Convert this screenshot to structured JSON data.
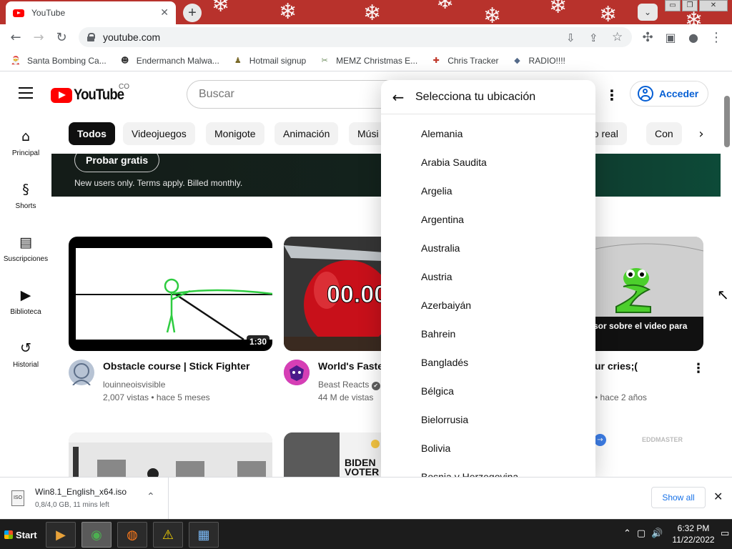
{
  "browser": {
    "tab_title": "YouTube",
    "tab_close": "✕",
    "new_tab": "+",
    "url": "youtube.com",
    "window_buttons": [
      "▭",
      "❐",
      "✕"
    ],
    "tab_search": "⌄",
    "nav_icons": {
      "back": "←",
      "forward": "→",
      "reload": "↻"
    },
    "omnibox_icons": {
      "install": "⇩",
      "share": "⇪",
      "star": "☆"
    },
    "toolbar_icons": {
      "extensions": "✣",
      "sidepanel": "▣",
      "profile": "●",
      "menu": "⋮"
    }
  },
  "bookmarks": [
    {
      "label": "Santa Bombing Ca...",
      "icon": "🎅",
      "color": "#c0392b"
    },
    {
      "label": "Endermanch Malwa...",
      "icon": "☻",
      "color": "#333333"
    },
    {
      "label": "Hotmail signup",
      "icon": "♟",
      "color": "#7a6a2a"
    },
    {
      "label": "MEMZ Christmas E...",
      "icon": "✂",
      "color": "#6a8a5a"
    },
    {
      "label": "Chris Tracker",
      "icon": "✚",
      "color": "#c0392b"
    },
    {
      "label": "RADIO!!!!",
      "icon": "◆",
      "color": "#556b8a"
    }
  ],
  "youtube": {
    "logo_text": "YouTube",
    "country_code": "CO",
    "search_placeholder": "Buscar",
    "more_icon": "⋮",
    "signin_label": "Acceder"
  },
  "chips": [
    "Todos",
    "Videojuegos",
    "Monigote",
    "Animación",
    "Músi",
    "po real",
    "Con"
  ],
  "chip_next": "›",
  "nav": [
    {
      "label": "Principal",
      "icon": "⌂"
    },
    {
      "label": "Shorts",
      "icon": "§"
    },
    {
      "label": "Suscripciones",
      "icon": "▤"
    },
    {
      "label": "Biblioteca",
      "icon": "▶"
    },
    {
      "label": "Historial",
      "icon": "↺"
    }
  ],
  "banner": {
    "button": "Probar gratis",
    "note": "New users only. Terms apply. Billed monthly."
  },
  "videos": [
    {
      "title": "Obstacle course | Stick Fighter",
      "channel": "louinneoisvisible",
      "views": "2,007 vistas",
      "age": "hace 5 meses",
      "duration": "1:30"
    },
    {
      "title": "World's Fastes",
      "channel": "Beast Reacts",
      "views": "44 M de vistas",
      "age": "",
      "timer": "00.00",
      "verified": "✔"
    },
    {
      "title": "ur cries;(",
      "channel": "",
      "views": "",
      "age": "hace 2 años",
      "overlay": "sor sobre el video para"
    }
  ],
  "row2": {
    "label1": "BIDEN",
    "label2": "VOTER",
    "watermark": "EDDMASTER"
  },
  "location_menu": {
    "title": "Selecciona tu ubicación",
    "back_icon": "←",
    "countries": [
      "Alemania",
      "Arabia Saudita",
      "Argelia",
      "Argentina",
      "Australia",
      "Austria",
      "Azerbaiyán",
      "Bahrein",
      "Bangladés",
      "Bélgica",
      "Bielorrusia",
      "Bolivia",
      "Bosnia y Herzegovina"
    ]
  },
  "download": {
    "filename": "Win8.1_English_x64.iso",
    "status": "0,8/4,0 GB, 11 mins left",
    "icon_label": "ISO",
    "chevron": "⌃",
    "show_all": "Show all",
    "close": "✕"
  },
  "taskbar": {
    "start": "Start",
    "apps": [
      {
        "name": "media-player",
        "icon": "▶",
        "color": "#e8a23a"
      },
      {
        "name": "chrome",
        "icon": "◉",
        "color": "#4caf50"
      },
      {
        "name": "firefox",
        "icon": "◍",
        "color": "#ff7a1a"
      },
      {
        "name": "explorer-warning",
        "icon": "⚠",
        "color": "#f5d300"
      },
      {
        "name": "control-panel",
        "icon": "▦",
        "color": "#7ab8f5"
      }
    ],
    "tray_icons": [
      "⌃",
      "▢",
      "🔊",
      "▭"
    ],
    "time": "6:32 PM",
    "date": "11/22/2022"
  }
}
